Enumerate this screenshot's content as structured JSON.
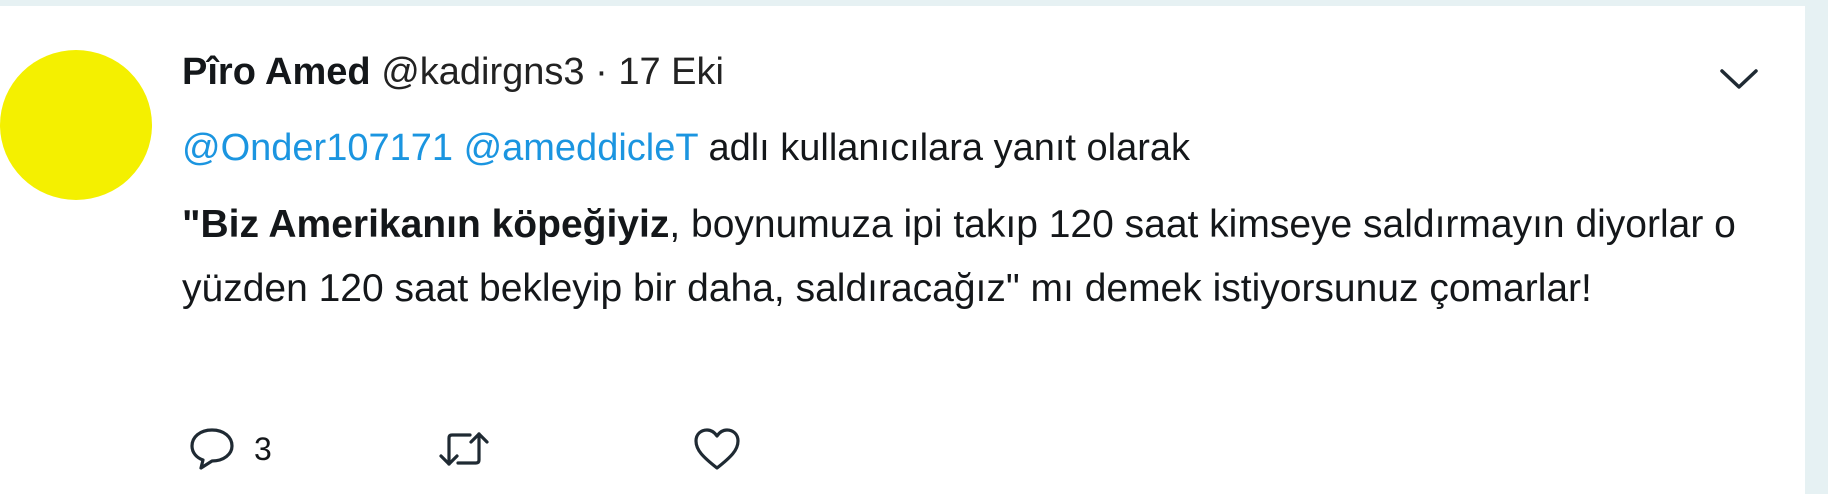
{
  "tweet": {
    "author_name": "Pîro Amed",
    "handle": "@kadirgns3",
    "separator": "·",
    "date": "17 Eki",
    "reply_to": {
      "mention_1": "@Onder107171",
      "mention_2": "@amеddicleT",
      "suffix": "adlı kullanıcılara yanıt olarak"
    },
    "text_bold": "\"Biz Amerikanın köpeğiyiz",
    "text_rest": ", boynumuza ipi takıp 120 saat kimseye saldırmayın diyorlar o yüzden 120 saat bekleyip bir daha, saldıracağız\" mı demek istiyorsunuz çomarlar!",
    "reply_count": "3"
  },
  "icons": {
    "avatar": "yellow-circle",
    "menu": "chevron-down-icon",
    "reply": "speech-bubble-icon",
    "retweet": "retweet-arrows-icon",
    "like": "heart-icon"
  },
  "colors": {
    "mention": "#1b95e0",
    "avatar": "#f4f000",
    "text": "#14171a",
    "background": "#e6f1f3"
  }
}
